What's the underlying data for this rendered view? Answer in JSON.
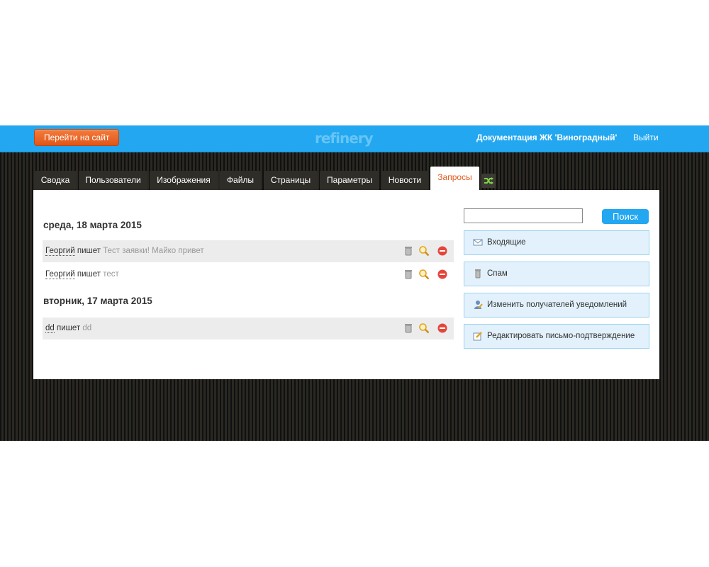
{
  "header": {
    "site_button": "Перейти на сайт",
    "logo": "refinery",
    "doc_title": "Документация ЖК 'Виноградный'",
    "logout": "Выйти"
  },
  "tabs": [
    {
      "label": "Сводка"
    },
    {
      "label": "Пользователи"
    },
    {
      "label": "Изображения"
    },
    {
      "label": "Файлы"
    },
    {
      "label": "Страницы"
    },
    {
      "label": "Параметры"
    },
    {
      "label": "Новости"
    },
    {
      "label": "Запросы",
      "active": true
    }
  ],
  "tab_switch_icon": "shuffle-icon",
  "inquiries": [
    {
      "date": "среда, 18 марта 2015",
      "items": [
        {
          "author": "Георгий",
          "verb": "пишет",
          "message": "Тест заявки! Майко привет"
        },
        {
          "author": "Георгий",
          "verb": "пишет",
          "message": "тест"
        }
      ]
    },
    {
      "date": "вторник, 17 марта 2015",
      "items": [
        {
          "author": "dd",
          "verb": "пишет",
          "message": "dd"
        }
      ]
    }
  ],
  "row_actions": [
    "trash-icon",
    "search-icon",
    "remove-icon"
  ],
  "search": {
    "placeholder": "",
    "value": "",
    "button": "Поиск"
  },
  "side_actions": [
    {
      "label": "Входящие",
      "icon": "envelope-icon"
    },
    {
      "label": "Спам",
      "icon": "trash-icon"
    },
    {
      "label": "Изменить получателей уведомлений",
      "icon": "user-edit-icon"
    },
    {
      "label": "Редактировать письмо-подтверждение",
      "icon": "edit-icon"
    }
  ],
  "colors": {
    "topbar": "#22a7f0",
    "accent_orange": "#e25a1c",
    "side_bg": "#e2f1fb"
  }
}
